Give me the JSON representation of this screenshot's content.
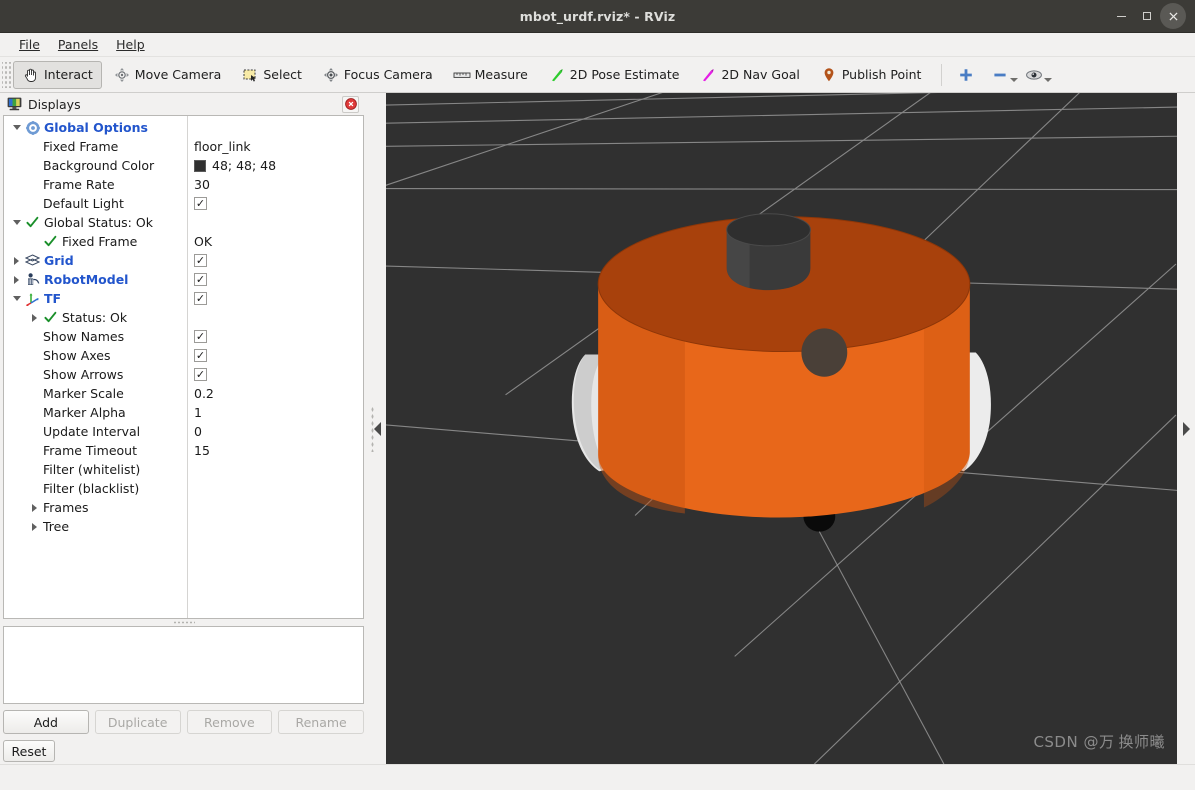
{
  "window": {
    "title": "mbot_urdf.rviz* - RViz",
    "minimize_label": "–",
    "maximize_label": "",
    "close_label": "✕"
  },
  "menubar": {
    "items": [
      {
        "label": "File"
      },
      {
        "label": "Panels"
      },
      {
        "label": "Help"
      }
    ]
  },
  "toolbar": {
    "buttons": [
      {
        "label": "Interact",
        "icon": "hand-cursor-icon",
        "active": true
      },
      {
        "label": "Move Camera",
        "icon": "move-camera-icon",
        "active": false
      },
      {
        "label": "Select",
        "icon": "select-rectangle-icon",
        "active": false
      },
      {
        "label": "Focus Camera",
        "icon": "focus-camera-icon",
        "active": false
      },
      {
        "label": "Measure",
        "icon": "ruler-icon",
        "active": false
      },
      {
        "label": "2D Pose Estimate",
        "icon": "green-arrow-icon",
        "active": false
      },
      {
        "label": "2D Nav Goal",
        "icon": "magenta-arrow-icon",
        "active": false
      },
      {
        "label": "Publish Point",
        "icon": "map-pin-icon",
        "active": false
      }
    ],
    "extra": [
      {
        "icon": "plus-icon"
      },
      {
        "icon": "minus-icon"
      },
      {
        "icon": "eye-icon"
      }
    ]
  },
  "displays_panel": {
    "title": "Displays",
    "icon": "monitor-icon",
    "close_icon": "close-circle-icon",
    "tree": [
      {
        "indent": 0,
        "arrow": "down",
        "icon": "gear-icon",
        "label": "Global Options",
        "style": "blue",
        "value_type": "none"
      },
      {
        "indent": 1,
        "arrow": "none",
        "icon": "none",
        "label": "Fixed Frame",
        "style": "plain",
        "value_type": "text",
        "value": "floor_link"
      },
      {
        "indent": 1,
        "arrow": "none",
        "icon": "none",
        "label": "Background Color",
        "style": "plain",
        "value_type": "color",
        "value": "48; 48; 48",
        "color": "#303030"
      },
      {
        "indent": 1,
        "arrow": "none",
        "icon": "none",
        "label": "Frame Rate",
        "style": "plain",
        "value_type": "text",
        "value": "30"
      },
      {
        "indent": 1,
        "arrow": "none",
        "icon": "none",
        "label": "Default Light",
        "style": "plain",
        "value_type": "checkbox",
        "value": "checked"
      },
      {
        "indent": 0,
        "arrow": "down",
        "icon": "check-icon",
        "label": "Global Status: Ok",
        "style": "plain",
        "value_type": "none"
      },
      {
        "indent": 1,
        "arrow": "none",
        "icon": "check-icon",
        "label": "Fixed Frame",
        "style": "plain",
        "value_type": "text",
        "value": "OK"
      },
      {
        "indent": 0,
        "arrow": "right",
        "icon": "grid-icon",
        "label": "Grid",
        "style": "blue",
        "value_type": "checkbox",
        "value": "checked"
      },
      {
        "indent": 0,
        "arrow": "right",
        "icon": "robot-icon",
        "label": "RobotModel",
        "style": "blue",
        "value_type": "checkbox",
        "value": "checked"
      },
      {
        "indent": 0,
        "arrow": "down",
        "icon": "tf-axes-icon",
        "label": "TF",
        "style": "blue",
        "value_type": "checkbox",
        "value": "checked"
      },
      {
        "indent": 1,
        "arrow": "right",
        "icon": "check-icon",
        "label": "Status: Ok",
        "style": "plain",
        "value_type": "none"
      },
      {
        "indent": 1,
        "arrow": "none",
        "icon": "none",
        "label": "Show Names",
        "style": "plain",
        "value_type": "checkbox",
        "value": "checked"
      },
      {
        "indent": 1,
        "arrow": "none",
        "icon": "none",
        "label": "Show Axes",
        "style": "plain",
        "value_type": "checkbox",
        "value": "checked"
      },
      {
        "indent": 1,
        "arrow": "none",
        "icon": "none",
        "label": "Show Arrows",
        "style": "plain",
        "value_type": "checkbox",
        "value": "checked"
      },
      {
        "indent": 1,
        "arrow": "none",
        "icon": "none",
        "label": "Marker Scale",
        "style": "plain",
        "value_type": "text",
        "value": "0.2"
      },
      {
        "indent": 1,
        "arrow": "none",
        "icon": "none",
        "label": "Marker Alpha",
        "style": "plain",
        "value_type": "text",
        "value": "1"
      },
      {
        "indent": 1,
        "arrow": "none",
        "icon": "none",
        "label": "Update Interval",
        "style": "plain",
        "value_type": "text",
        "value": "0"
      },
      {
        "indent": 1,
        "arrow": "none",
        "icon": "none",
        "label": "Frame Timeout",
        "style": "plain",
        "value_type": "text",
        "value": "15"
      },
      {
        "indent": 1,
        "arrow": "none",
        "icon": "none",
        "label": "Filter (whitelist)",
        "style": "plain",
        "value_type": "none"
      },
      {
        "indent": 1,
        "arrow": "none",
        "icon": "none",
        "label": "Filter (blacklist)",
        "style": "plain",
        "value_type": "none"
      },
      {
        "indent": 1,
        "arrow": "right",
        "icon": "none",
        "label": "Frames",
        "style": "plain",
        "value_type": "none"
      },
      {
        "indent": 1,
        "arrow": "right",
        "icon": "none",
        "label": "Tree",
        "style": "plain",
        "value_type": "none"
      }
    ],
    "buttons": [
      {
        "label": "Add",
        "enabled": true
      },
      {
        "label": "Duplicate",
        "enabled": false
      },
      {
        "label": "Remove",
        "enabled": false
      },
      {
        "label": "Rename",
        "enabled": false
      }
    ],
    "reset_label": "Reset"
  },
  "viewport": {
    "background_color": "#303030",
    "grid_line_color": "#9a9a9a",
    "robot": {
      "body_color": "#e8671a",
      "body_top_color": "#a8410c",
      "sensor_color": "#3a3a3a",
      "sensor_top_color": "#4a4a4a",
      "wheel_color": "#e8e8e8",
      "caster_color": "#0c0c0c",
      "port_color": "#4a4038"
    },
    "watermark": "CSDN @万",
    "watermark_2": "换师曦"
  }
}
